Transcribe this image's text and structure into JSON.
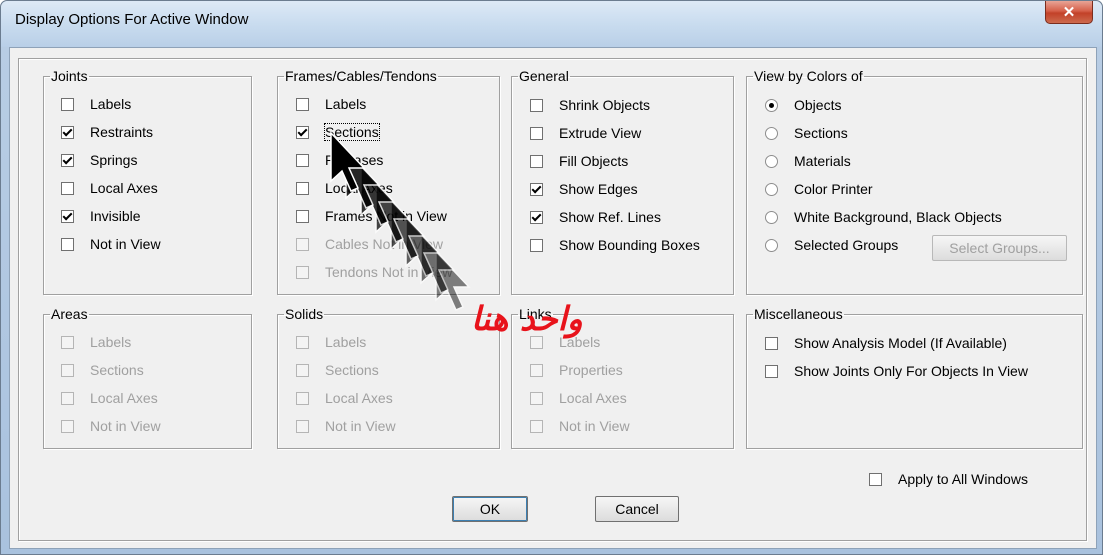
{
  "window": {
    "title": "Display Options For Active Window",
    "close_glyph": "✕"
  },
  "groups": {
    "joints": {
      "legend": "Joints",
      "items": [
        {
          "label": "Labels",
          "checked": false
        },
        {
          "label": "Restraints",
          "checked": true
        },
        {
          "label": "Springs",
          "checked": true
        },
        {
          "label": "Local Axes",
          "checked": false
        },
        {
          "label": "Invisible",
          "checked": true
        },
        {
          "label": "Not in View",
          "checked": false
        }
      ]
    },
    "frames": {
      "legend": "Frames/Cables/Tendons",
      "items": [
        {
          "label": "Labels",
          "checked": false
        },
        {
          "label": "Sections",
          "checked": true
        },
        {
          "label": "Releases",
          "checked": false
        },
        {
          "label": "Local Axes",
          "checked": false
        },
        {
          "label": "Frames Not in View",
          "checked": false
        },
        {
          "label": "Cables Not in View",
          "checked": false,
          "disabled": true
        },
        {
          "label": "Tendons Not in View",
          "checked": false,
          "disabled": true
        }
      ]
    },
    "general": {
      "legend": "General",
      "items": [
        {
          "label": "Shrink Objects",
          "checked": false
        },
        {
          "label": "Extrude View",
          "checked": false
        },
        {
          "label": "Fill Objects",
          "checked": false
        },
        {
          "label": "Show Edges",
          "checked": true
        },
        {
          "label": "Show Ref. Lines",
          "checked": true
        },
        {
          "label": "Show Bounding Boxes",
          "checked": false
        }
      ]
    },
    "view_by_colors": {
      "legend": "View by Colors of",
      "options": [
        "Objects",
        "Sections",
        "Materials",
        "Color Printer",
        "White Background, Black Objects",
        "Selected Groups"
      ],
      "selected": "Objects",
      "select_groups_button": "Select Groups..."
    },
    "areas": {
      "legend": "Areas",
      "items": [
        {
          "label": "Labels"
        },
        {
          "label": "Sections"
        },
        {
          "label": "Local Axes"
        },
        {
          "label": "Not in View"
        }
      ]
    },
    "solids": {
      "legend": "Solids",
      "items": [
        {
          "label": "Labels"
        },
        {
          "label": "Sections"
        },
        {
          "label": "Local Axes"
        },
        {
          "label": "Not in View"
        }
      ]
    },
    "links": {
      "legend": "Links",
      "items": [
        {
          "label": "Labels"
        },
        {
          "label": "Properties"
        },
        {
          "label": "Local Axes"
        },
        {
          "label": "Not in View"
        }
      ]
    },
    "misc": {
      "legend": "Miscellaneous",
      "items": [
        {
          "label": "Show Analysis Model  (If Available)",
          "checked": false
        },
        {
          "label": "Show Joints Only For Objects In View",
          "checked": false
        }
      ]
    }
  },
  "apply_all": {
    "label": "Apply to All Windows",
    "checked": false
  },
  "buttons": {
    "ok": "OK",
    "cancel": "Cancel"
  },
  "annotation": {
    "text": "واحد هنا",
    "color": "#e8131b"
  }
}
